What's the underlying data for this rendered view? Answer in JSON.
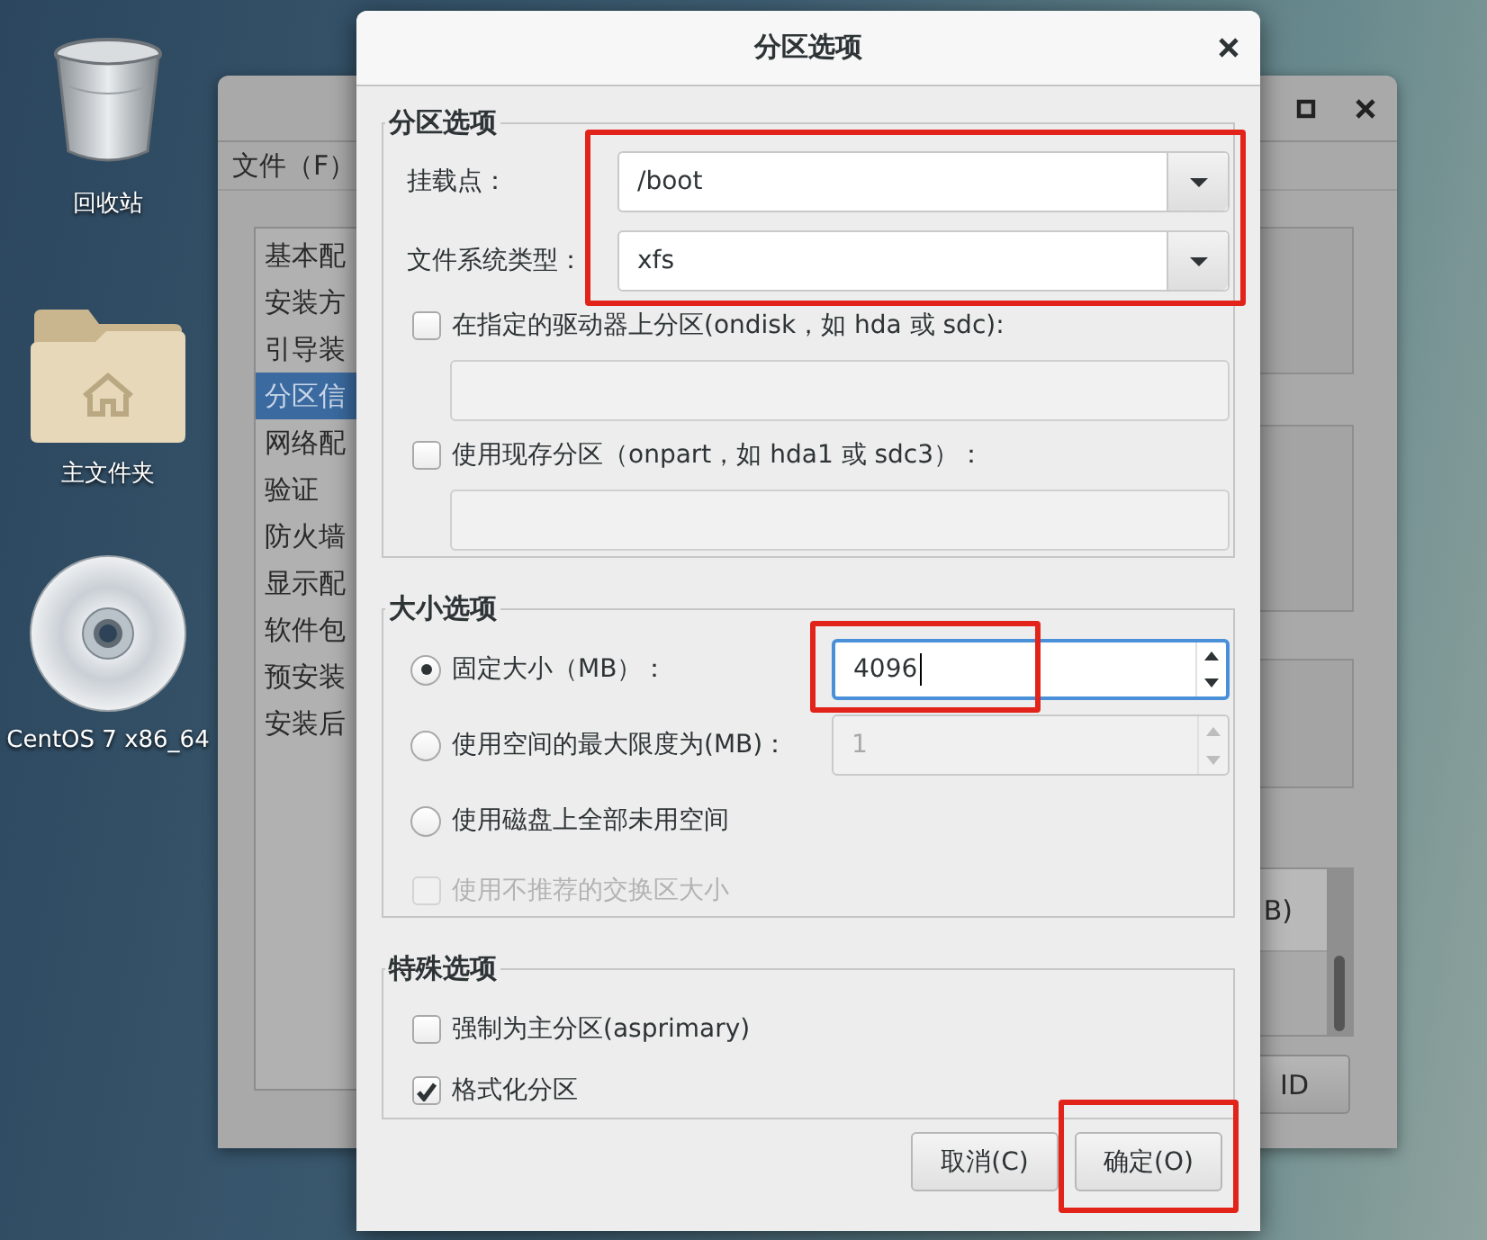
{
  "desktop_icons": [
    {
      "kind": "trash",
      "label": "回收站"
    },
    {
      "kind": "home_folder",
      "label": "主文件夹"
    },
    {
      "kind": "disc",
      "label": "CentOS 7 x86_64"
    }
  ],
  "back_window": {
    "menu": [
      "文件（F）"
    ],
    "sidebar_items": [
      {
        "label": "基本配",
        "selected": false
      },
      {
        "label": "安装方",
        "selected": false
      },
      {
        "label": "引导装",
        "selected": false
      },
      {
        "label": "分区信",
        "selected": true
      },
      {
        "label": "网络配",
        "selected": false
      },
      {
        "label": "验证",
        "selected": false
      },
      {
        "label": "防火墙",
        "selected": false
      },
      {
        "label": "显示配",
        "selected": false
      },
      {
        "label": "软件包",
        "selected": false
      },
      {
        "label": "预安装",
        "selected": false
      },
      {
        "label": "安装后",
        "selected": false
      }
    ],
    "list_cell": "B)",
    "button": "ID"
  },
  "dialog": {
    "title": "分区选项",
    "sections": [
      {
        "title": "分区选项",
        "rows": [
          {
            "kind": "group",
            "highlighted": true,
            "rows": [
              {
                "kind": "combo",
                "label": "挂载点：",
                "value": "/boot"
              },
              {
                "kind": "combo",
                "label": "文件系统类型：",
                "value": "xfs"
              }
            ]
          },
          {
            "kind": "checkbox",
            "label": "在指定的驱动器上分区(ondisk，如 hda 或 sdc):",
            "checked": false,
            "disabled": false
          },
          {
            "kind": "field",
            "disabled": true
          },
          {
            "kind": "checkbox",
            "label": "使用现存分区（onpart，如 hda1 或 sdc3）：",
            "checked": false,
            "disabled": false
          },
          {
            "kind": "field",
            "disabled": true
          }
        ]
      },
      {
        "title": "大小选项",
        "rows": [
          {
            "kind": "radio",
            "label": "固定大小（MB）：",
            "selected": true,
            "spin": {
              "value": "4096",
              "disabled": false,
              "focused": true,
              "highlighted": true
            }
          },
          {
            "kind": "radio",
            "label": "使用空间的最大限度为(MB)：",
            "selected": false,
            "spin": {
              "value": "1",
              "disabled": true,
              "focused": false,
              "highlighted": false
            }
          },
          {
            "kind": "radio",
            "label": "使用磁盘上全部未用空间",
            "selected": false
          },
          {
            "kind": "checkbox",
            "label": "使用不推荐的交换区大小",
            "checked": false,
            "disabled": true
          }
        ]
      },
      {
        "title": "特殊选项",
        "rows": [
          {
            "kind": "checkbox",
            "label": "强制为主分区(asprimary)",
            "checked": false,
            "disabled": false
          },
          {
            "kind": "checkbox",
            "label": "格式化分区",
            "checked": true,
            "disabled": false
          }
        ]
      }
    ],
    "buttons": [
      {
        "label": "取消(C)",
        "highlighted": false
      },
      {
        "label": "确定(O)",
        "highlighted": true
      }
    ]
  }
}
